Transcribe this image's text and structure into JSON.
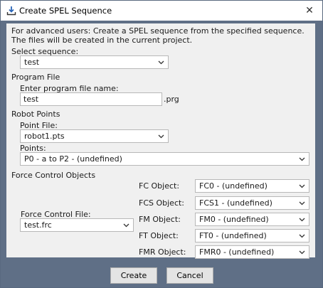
{
  "window": {
    "title": "Create SPEL Sequence",
    "close_glyph": "✕"
  },
  "intro": {
    "line1": "For advanced users: Create a SPEL sequence from the specified sequence.",
    "line2": "The files will be created in the current project."
  },
  "sequence": {
    "label": "Select sequence:",
    "value": "test"
  },
  "program_file": {
    "section": "Program File",
    "label": "Enter program file name:",
    "value": "test",
    "extension": ".prg"
  },
  "robot_points": {
    "section": "Robot Points",
    "point_file_label": "Point File:",
    "point_file_value": "robot1.pts",
    "points_label": "Points:",
    "points_value": "P0 - a to P2 - (undefined)"
  },
  "force_control": {
    "section": "Force Control Objects",
    "file_label": "Force Control File:",
    "file_value": "test.frc",
    "objects": [
      {
        "label": "FC Object:",
        "value": "FC0 - (undefined)"
      },
      {
        "label": "FCS Object:",
        "value": "FCS1 - (undefined)"
      },
      {
        "label": "FM Object:",
        "value": "FM0 - (undefined)"
      },
      {
        "label": "FT Object:",
        "value": "FT0 - (undefined)"
      },
      {
        "label": "FMR Object:",
        "value": "FMR0 - (undefined)"
      }
    ]
  },
  "buttons": {
    "create": "Create",
    "cancel": "Cancel"
  },
  "icons": {
    "title": "download-icon",
    "dropdown": "chevron-down-icon",
    "close": "close-icon"
  },
  "colors": {
    "frame": "#5f6f86",
    "panel": "#f0f0f0",
    "field_border": "#b8b8b8"
  }
}
